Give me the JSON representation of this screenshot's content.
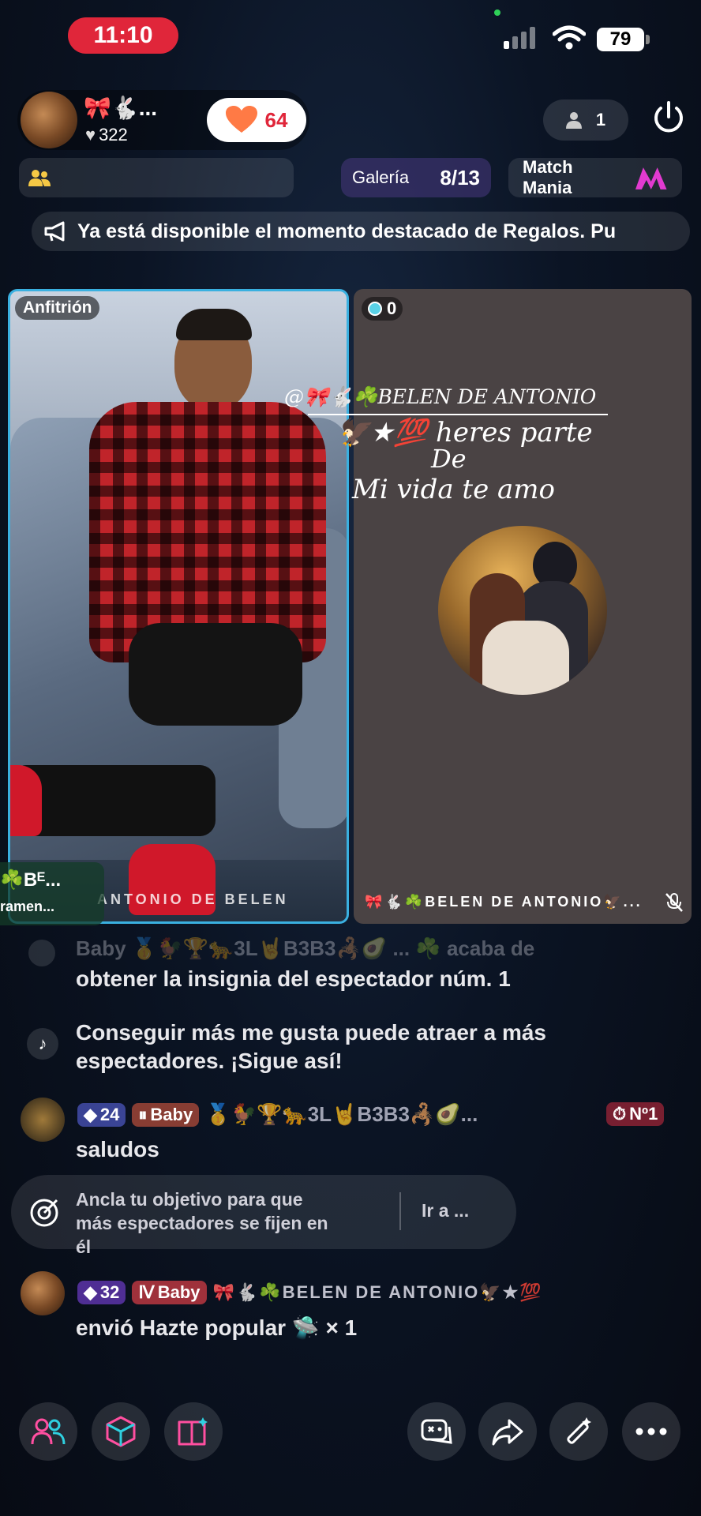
{
  "status_bar": {
    "time": "11:10",
    "battery": "79"
  },
  "host": {
    "name": "🎀🐇...",
    "likes": "322",
    "hearts": "64"
  },
  "viewers": {
    "count": "1"
  },
  "tabs": {
    "gallery_label": "Galería",
    "gallery_count": "8/13",
    "match_label": "Match Mania"
  },
  "banner": {
    "text": "Ya está disponible el momento destacado de Regalos. Pu"
  },
  "left_panel": {
    "badge": "Anfitrión",
    "bottom_name": "ANTONIO DE BELEN",
    "side_name": "☘️Bᴱ...",
    "side_sub": "ramen..."
  },
  "right_panel": {
    "score": "0",
    "caption_line1": "@🎀🐇☘️BELEN DE ANTONIO",
    "caption_line2": "🦅★💯 heres parte",
    "caption_line3": "De",
    "caption_line4": "Mi vida te amo",
    "bottom_name": "🎀🐇☘️BELEN DE ANTONIO🦅..."
  },
  "chat": {
    "faded_line": "Baby 🥇🐓🏆🐆3L🤘B3B3🦂🥑 ... ☘️ acaba de",
    "msg1": "obtener la insignia del espectador núm. 1",
    "msg2": "Conseguir más me gusta puede atraer a más espectadores. ¡Sigue así!",
    "user1_level": "24",
    "user1_badge": "Baby",
    "user1_name": "🥇🐓🏆🐆3L🤘B3B3🦂🥑...",
    "user1_rank": "Nº1",
    "user1_msg": "saludos",
    "goal_text": "Ancla tu objetivo para que más espectadores se fijen en él",
    "goal_action": "Ir a ...",
    "user2_level": "32",
    "user2_badge": "Baby",
    "user2_name": "🎀🐇☘️BELEN DE ANTONIO🦅★💯",
    "user2_msg": "envió Hazte popular 🛸 × 1"
  },
  "colors": {
    "accent_red": "#e0263a",
    "host_border": "#3ab0e0",
    "heart_orange": "#ff7a45"
  }
}
